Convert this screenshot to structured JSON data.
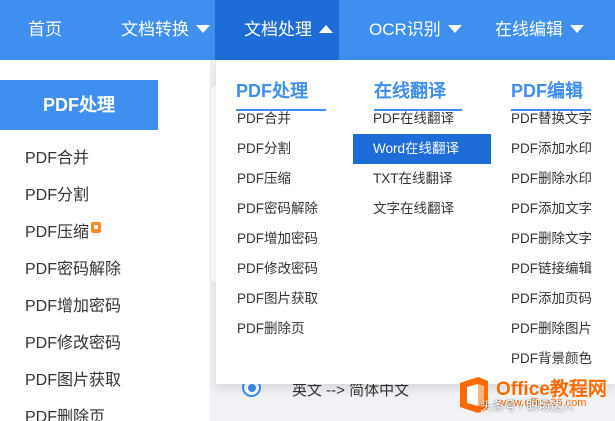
{
  "nav": {
    "home": "首页",
    "convert": "文档转换",
    "process": "文档处理",
    "ocr": "OCR识别",
    "edit": "在线编辑"
  },
  "sidebar": {
    "title": "PDF处理",
    "items": [
      "PDF合并",
      "PDF分割",
      "PDF压缩",
      "PDF密码解除",
      "PDF增加密码",
      "PDF修改密码",
      "PDF图片获取",
      "PDF删除页"
    ]
  },
  "dropdown": {
    "columns": [
      {
        "title": "PDF处理",
        "items": [
          "PDF合并",
          "PDF分割",
          "PDF压缩",
          "PDF密码解除",
          "PDF增加密码",
          "PDF修改密码",
          "PDF图片获取",
          "PDF删除页"
        ]
      },
      {
        "title": "在线翻译",
        "items": [
          "PDF在线翻译",
          "Word在线翻译",
          "TXT在线翻译",
          "文字在线翻译"
        ]
      },
      {
        "title": "PDF编辑",
        "items": [
          "PDF替换文字",
          "PDF添加水印",
          "PDF删除水印",
          "PDF添加文字",
          "PDF删除文字",
          "PDF链接编辑",
          "PDF添加页码",
          "PDF删除图片",
          "PDF背景颜色"
        ]
      }
    ],
    "highlighted": "Word在线翻译"
  },
  "content": {
    "radio_label": "英文 --> 简体中文"
  },
  "watermark": {
    "brand": "Office教程网",
    "url": "www.office26.com",
    "caption": "头条号 / 职场达人"
  },
  "colors": {
    "primary": "#3e8ff0",
    "active_nav": "#1e6cd8",
    "highlight": "#1e6cd8",
    "watermark": "#ff6a00"
  }
}
